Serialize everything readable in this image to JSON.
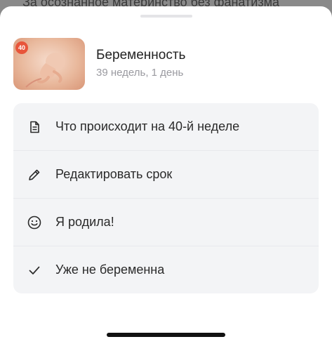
{
  "backdrop": {
    "text": "За осознанное материнство без фанатизма"
  },
  "header": {
    "badge": "40",
    "title": "Беременность",
    "subtitle": "39 недель, 1 день"
  },
  "menu": {
    "items": [
      {
        "label": "Что происходит на 40-й неделе",
        "icon": "document-icon"
      },
      {
        "label": "Редактировать срок",
        "icon": "pencil-icon"
      },
      {
        "label": "Я родила!",
        "icon": "smile-icon"
      },
      {
        "label": "Уже не беременна",
        "icon": "checkmark-icon"
      }
    ]
  },
  "colors": {
    "badge": "#e8553a",
    "menu_background": "#f3f4f6",
    "subtitle": "#9a9aa0"
  }
}
